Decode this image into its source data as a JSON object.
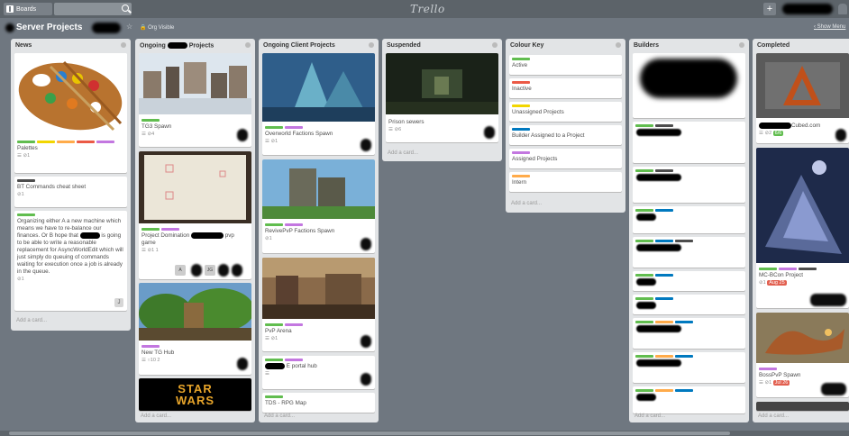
{
  "topbar": {
    "boards_label": "Boards",
    "logo": "Trello",
    "plus_label": "+"
  },
  "board": {
    "title": "Server Projects",
    "visibility": "Org Visible",
    "show_menu": "Show Menu"
  },
  "colors": {
    "green": "#61bd4f",
    "yellow": "#f2d600",
    "orange": "#ffab4a",
    "red": "#eb5a46",
    "purple": "#c377e0",
    "blue": "#0079bf",
    "dark": "#4d4d4d",
    "due_red": "#e25f4f",
    "due_green": "#61bd4f"
  },
  "lists": {
    "news": {
      "name": "News",
      "cards": [
        {
          "title": "Palettes",
          "meta": "1"
        },
        {
          "title": "BT Commands cheat sheet",
          "meta": "1"
        },
        {
          "title": "Organizing either A a new machine which means we have to re-balance our finances. Or B hope that",
          "title2": "is going to be able to write a reasonable replacement for AsyncWorldEdit which will just simply do queuing of commands waiting for execution once a job is already in the queue.",
          "meta": "1",
          "badge": "J"
        }
      ],
      "add_card": "Add a card..."
    },
    "ongoing": {
      "name_a": "Ongoing",
      "name_b": "Projects",
      "cards": [
        {
          "title": "TG3 Spawn",
          "meta": "4"
        },
        {
          "title": "Project Domination",
          "title_b": "pvp game",
          "meta": "1   1",
          "members": [
            "A",
            "JG"
          ]
        },
        {
          "title": "New TG Hub",
          "meta": "10   2"
        },
        {
          "title": "STAR WARS"
        }
      ],
      "add_card": "Add a card..."
    },
    "client": {
      "name": "Ongoing Client Projects",
      "cards": [
        {
          "title": "Overworld Factions Spawn",
          "meta": "1"
        },
        {
          "title": "RevivePvP Factions Spawn",
          "meta": "1"
        },
        {
          "title": "PvP Arena",
          "meta": "1"
        },
        {
          "title": "E portal hub"
        },
        {
          "title": "TDS - RPG Map"
        }
      ],
      "add_card": "Add a card..."
    },
    "suspended": {
      "name": "Suspended",
      "cards": [
        {
          "title": "Prison sewers",
          "meta": "6"
        }
      ],
      "add_card": "Add a card..."
    },
    "colour_key": {
      "name": "Colour Key",
      "cards": [
        {
          "title": "Active"
        },
        {
          "title": "Inactive"
        },
        {
          "title": "Unassigned Projects"
        },
        {
          "title": "Builder Assigned to a Project"
        },
        {
          "title": "Assigned Projects"
        },
        {
          "title": "Intern"
        }
      ],
      "add_card": "Add a card..."
    },
    "builders": {
      "name": "Builders",
      "add_card": "Add a card..."
    },
    "completed": {
      "name": "Completed",
      "cards": [
        {
          "title": "Cubed.com",
          "meta": "2",
          "badge": "6/6"
        },
        {
          "title": "MC-BCon Project",
          "meta": "1",
          "due": "Aug 25"
        },
        {
          "title": "BossPvP Spawn",
          "meta": "1",
          "due": "Jul 26"
        }
      ],
      "add_card": "Add a card..."
    }
  }
}
